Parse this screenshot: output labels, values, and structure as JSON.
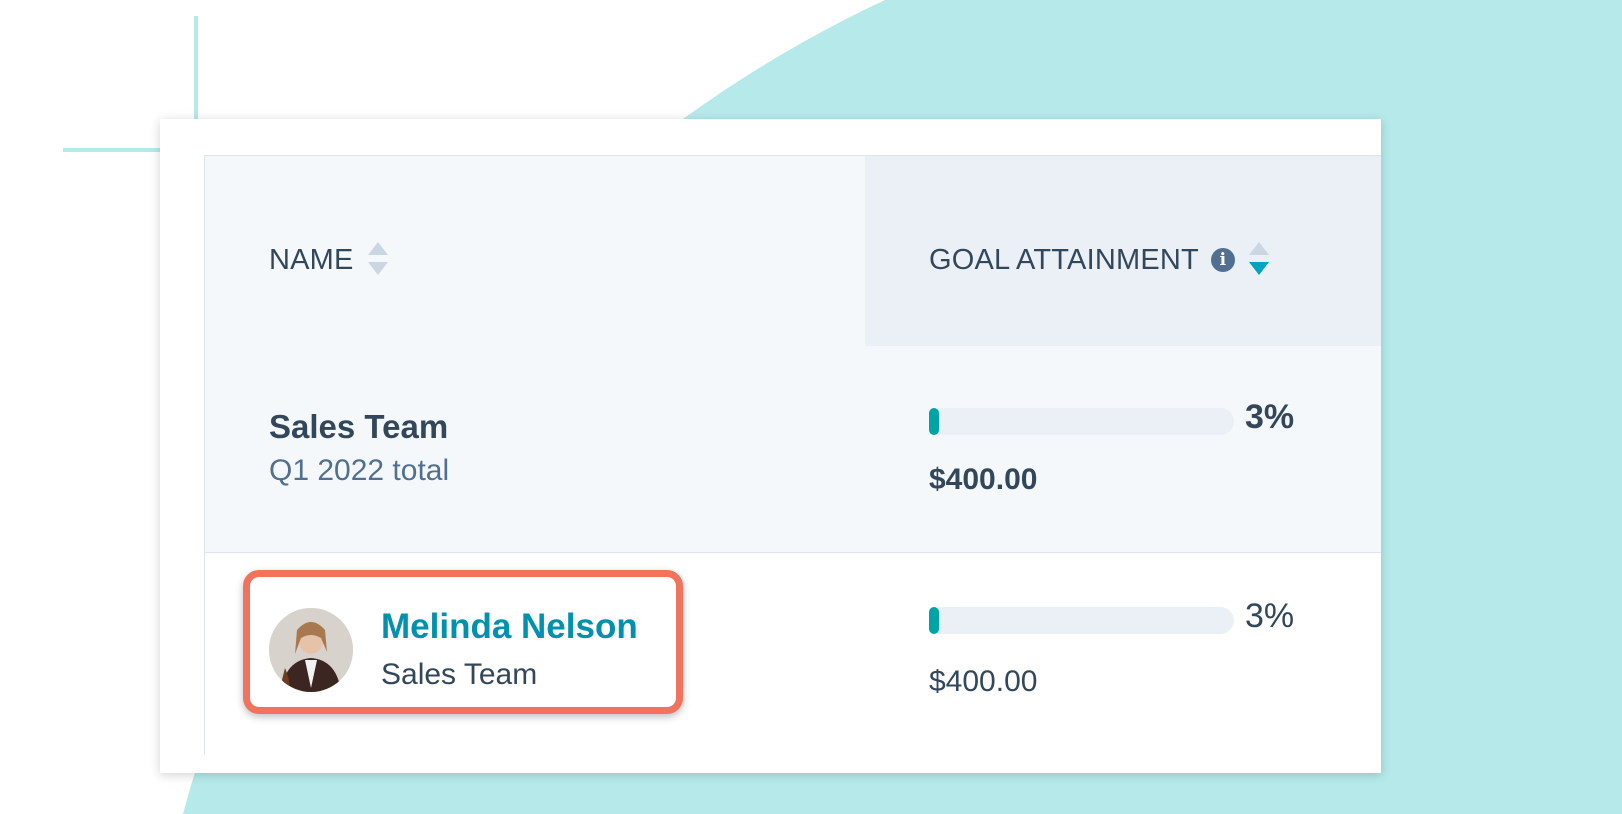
{
  "colors": {
    "accent_teal": "#00a4bd",
    "bar_fill": "#00a4a6",
    "highlight_border": "#f2735d",
    "background_shape": "#b6eaea",
    "link": "#0091ae"
  },
  "table": {
    "columns": [
      {
        "label": "NAME",
        "sortable": true,
        "sort_icon": "sort-icon"
      },
      {
        "label": "GOAL ATTAINMENT",
        "info_icon": "info-icon",
        "info_glyph": "i",
        "sortable": true,
        "sort_direction": "descending"
      }
    ],
    "rows": [
      {
        "name": "Sales Team",
        "subtitle": "Q1 2022 total",
        "progress_percent": 3,
        "percent_label": "3%",
        "amount": "$400.00"
      },
      {
        "name": "Melinda Nelson",
        "subtitle": "Sales Team",
        "avatar_icon": "user-avatar",
        "highlighted": true,
        "progress_percent": 3,
        "percent_label": "3%",
        "amount": "$400.00"
      }
    ]
  }
}
